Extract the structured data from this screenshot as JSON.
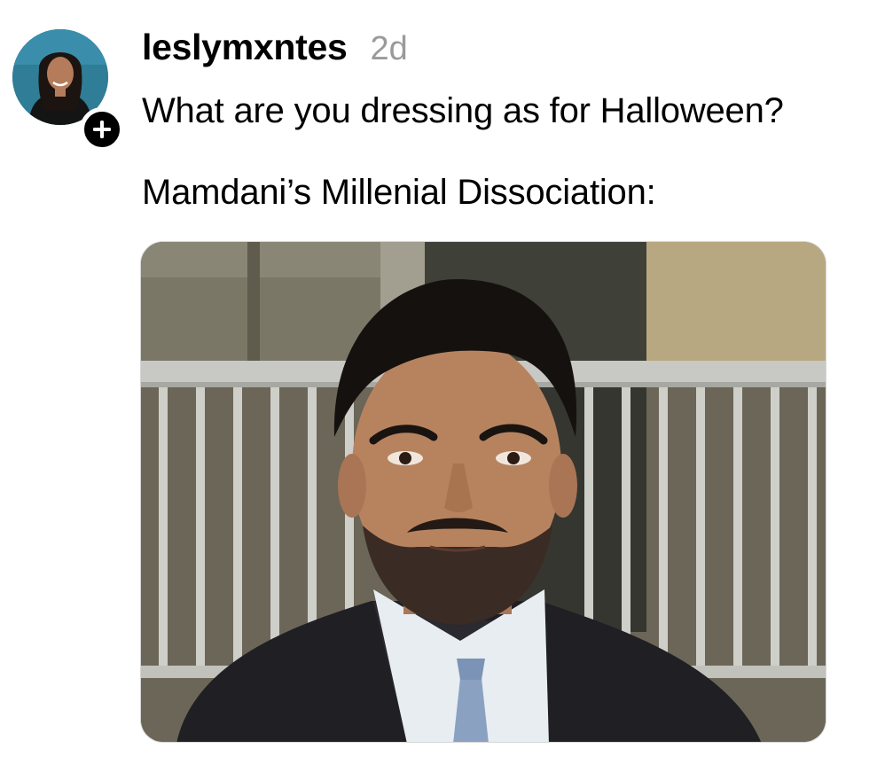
{
  "post": {
    "username": "leslymxntes",
    "timestamp": "2d",
    "text_lines": [
      "What are you dressing as for Halloween?",
      "Mamdani’s Millenial Dissociation:"
    ],
    "avatar_icon": "profile-photo",
    "follow_icon": "plus-icon",
    "image": "photo-of-man-in-suit-in-front-of-railing"
  },
  "colors": {
    "text": "#000000",
    "timestamp": "#9a9a9a",
    "avatar_bg": "#2f7d96",
    "follow_badge": "#000000"
  }
}
